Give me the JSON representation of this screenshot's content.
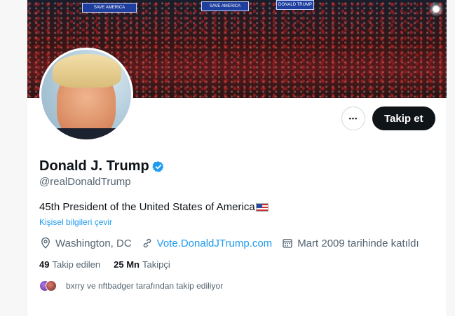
{
  "banner": {
    "sign_texts": [
      "SAVE AMERICA",
      "SAVE AMERICA",
      "DONALD TRUMP"
    ]
  },
  "actions": {
    "more_label": "•••",
    "follow_label": "Takip et"
  },
  "profile": {
    "name": "Donald J. Trump",
    "handle": "@realDonaldTrump",
    "bio": "45th President of the United States of America",
    "translate_label": "Kişisel bilgileri çevir",
    "location": "Washington, DC",
    "website": "Vote.DonaldJTrump.com",
    "joined": "Mart 2009 tarihinde katıldı"
  },
  "stats": {
    "following_count": "49",
    "following_label": "Takip edilen",
    "followers_count": "25 Mn",
    "followers_label": "Takipçi"
  },
  "followed_by": {
    "text": "bxrry ve nftbadger tarafından takip ediliyor"
  },
  "colors": {
    "accent": "#1d9bf0",
    "text": "#0f1419",
    "muted": "#536471",
    "button": "#0f1419"
  },
  "icons": [
    "verified-badge-icon",
    "more-icon",
    "location-icon",
    "link-icon",
    "calendar-icon",
    "us-flag-icon"
  ]
}
